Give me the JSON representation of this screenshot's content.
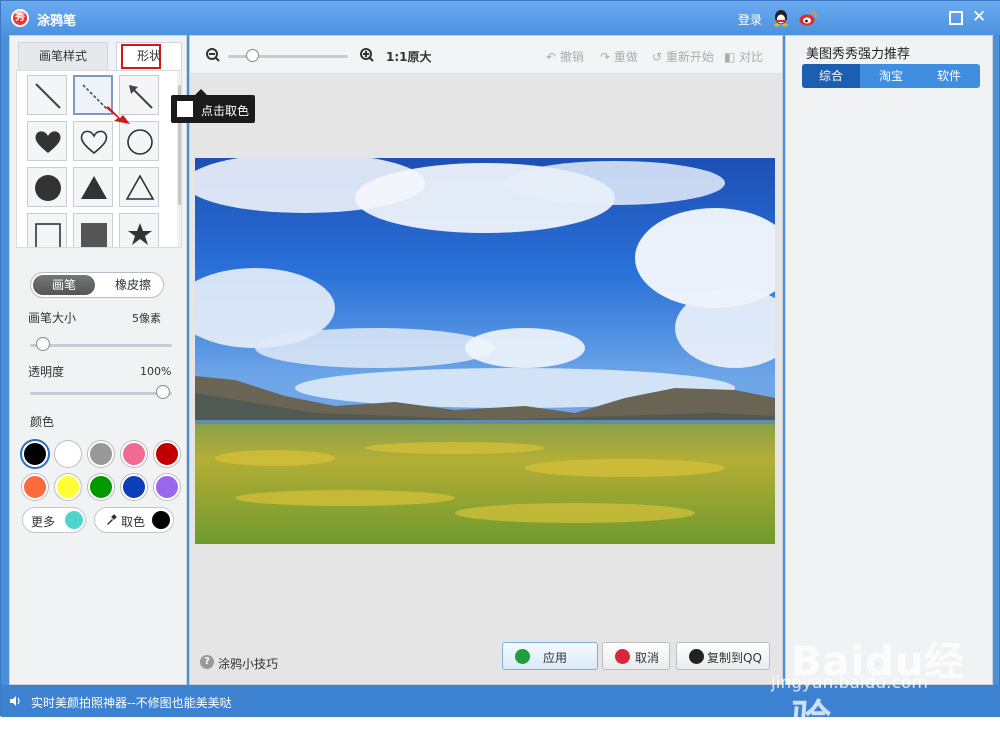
{
  "window": {
    "title": "涂鸦笔",
    "app_icon_char": "秀"
  },
  "titlebar": {
    "login_label": "登录"
  },
  "left_panel": {
    "tabs": [
      {
        "label": "画笔样式"
      },
      {
        "label": "形状"
      }
    ],
    "shapes": [
      "line-icon",
      "dashed-line-icon",
      "arrow-icon",
      "filled-heart-icon",
      "outline-heart-icon",
      "outline-circle-icon",
      "filled-circle-icon",
      "filled-triangle-icon",
      "outline-triangle-icon",
      "outline-square-icon",
      "filled-square-icon",
      "filled-star-icon"
    ],
    "mode_toggle": {
      "brush": "画笔",
      "eraser": "橡皮擦"
    },
    "brush_size": {
      "label": "画笔大小",
      "value": "5像素"
    },
    "opacity": {
      "label": "透明度",
      "value": "100%"
    },
    "colors": {
      "label": "颜色",
      "swatches": [
        "#000000",
        "#ffffff",
        "#999999",
        "#f06a94",
        "#c00000",
        "#ff6a3d",
        "#ffff33",
        "#009900",
        "#0a3fb8",
        "#9966ee"
      ],
      "more_label": "更多",
      "more_color": "#4fd6cc",
      "pick_label": "取色",
      "pick_color": "#000000"
    }
  },
  "canvas": {
    "zoom_label": "1:1原大",
    "zoom_level": 0.2,
    "undo": "撤销",
    "redo": "重做",
    "restart": "重新开始",
    "compare": "对比",
    "tooltip": "点击取色",
    "tips_label": "涂鸦小技巧",
    "apply": "应用",
    "cancel": "取消",
    "copy_qq": "复制到QQ"
  },
  "right_panel": {
    "title": "美图秀秀强力推荐",
    "tabs": [
      {
        "label": "综合"
      },
      {
        "label": "淘宝"
      },
      {
        "label": "软件"
      }
    ]
  },
  "statusbar": {
    "text": "实时美颜拍照神器--不修图也能美美哒"
  },
  "watermark": {
    "main": "Baidu经验",
    "url": "jingyan.baidu.com"
  }
}
